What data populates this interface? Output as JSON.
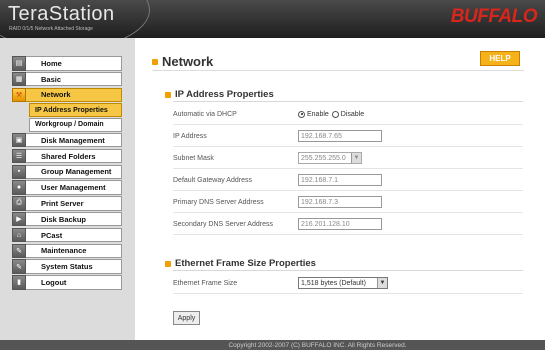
{
  "header": {
    "product_name": "TeraStation",
    "product_subtitle": "RAID 0/1/5 Network Attached Storage",
    "brand": "BUFFALO"
  },
  "sidebar": {
    "items": [
      {
        "label": "Home",
        "icon": "home-icon"
      },
      {
        "label": "Basic",
        "icon": "basic-icon"
      },
      {
        "label": "Network",
        "icon": "network-icon",
        "active": true
      },
      {
        "label": "IP Address Properties",
        "sub": true,
        "active": true
      },
      {
        "label": "Workgroup / Domain",
        "sub": true
      },
      {
        "label": "Disk Management",
        "icon": "disk-icon"
      },
      {
        "label": "Shared Folders",
        "icon": "folder-icon"
      },
      {
        "label": "Group Management",
        "icon": "group-icon"
      },
      {
        "label": "User Management",
        "icon": "user-icon"
      },
      {
        "label": "Print Server",
        "icon": "printer-icon"
      },
      {
        "label": "Disk Backup",
        "icon": "backup-icon"
      },
      {
        "label": "PCast",
        "icon": "pcast-icon"
      },
      {
        "label": "Maintenance",
        "icon": "maintenance-icon"
      },
      {
        "label": "System Status",
        "icon": "status-icon"
      },
      {
        "label": "Logout",
        "icon": "logout-icon"
      }
    ]
  },
  "main": {
    "title": "Network",
    "help_label": "HELP",
    "ip_section": {
      "title": "IP Address Properties",
      "dhcp_label": "Automatic via DHCP",
      "dhcp_enable": "Enable",
      "dhcp_disable": "Disable",
      "ip_label": "IP Address",
      "ip_value": "192.168.7.65",
      "mask_label": "Subnet Mask",
      "mask_value": "255.255.255.0",
      "gateway_label": "Default Gateway Address",
      "gateway_value": "192.168.7.1",
      "dns1_label": "Primary DNS Server Address",
      "dns1_value": "192.168.7.3",
      "dns2_label": "Secondary DNS Server Address",
      "dns2_value": "216.201.128.10"
    },
    "frame_section": {
      "title": "Ethernet Frame Size Properties",
      "frame_label": "Ethernet Frame Size",
      "frame_value": "1,518 bytes (Default)"
    },
    "apply_label": "Apply"
  },
  "footer": {
    "copyright": "Copyright 2002-2007 (C) BUFFALO INC. All Rights Reserved."
  },
  "colors": {
    "accent": "#f6c744",
    "brand_red": "#d9261c",
    "help_orange": "#f6b21a"
  }
}
